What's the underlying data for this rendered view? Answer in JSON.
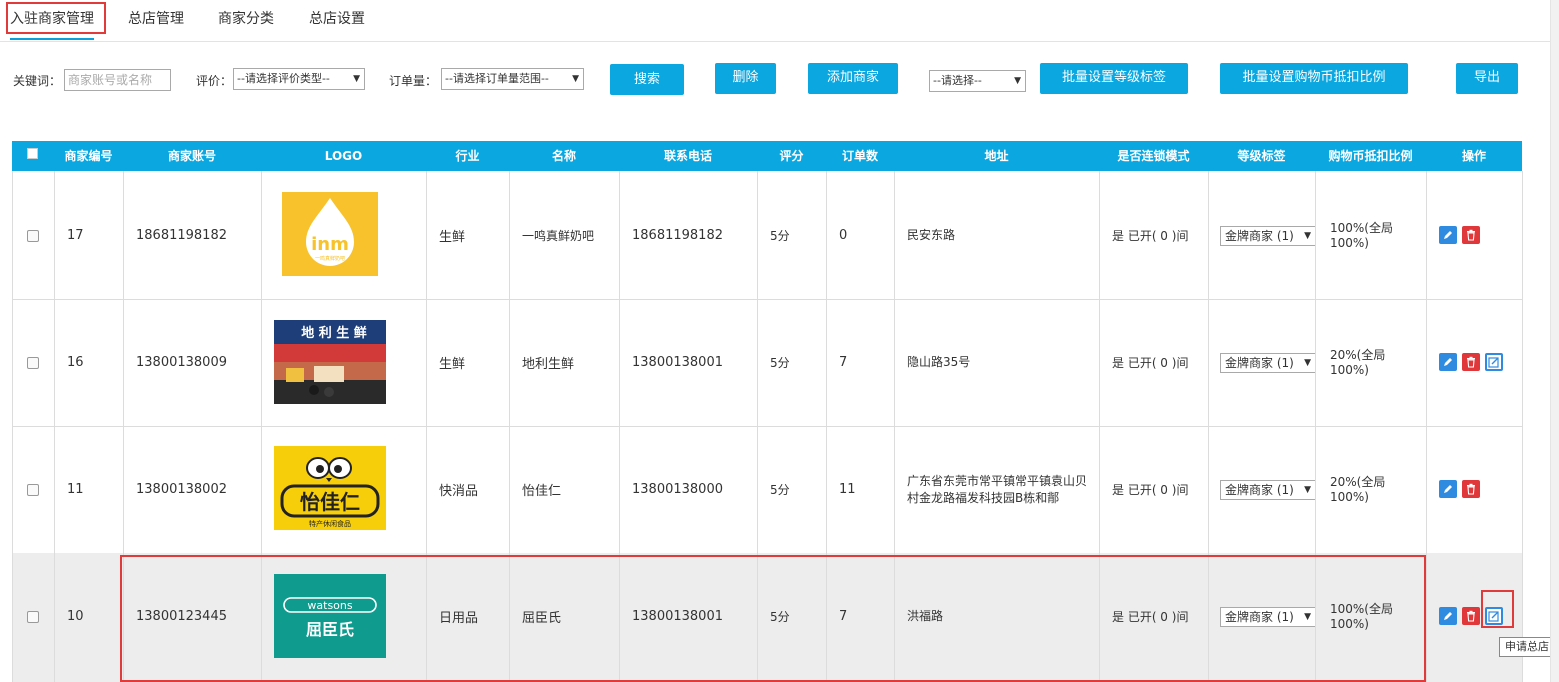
{
  "tabs": [
    {
      "label": "入驻商家管理",
      "active": true
    },
    {
      "label": "总店管理",
      "active": false
    },
    {
      "label": "商家分类",
      "active": false
    },
    {
      "label": "总店设置",
      "active": false
    }
  ],
  "filters": {
    "keyword_label": "关键词：",
    "keyword_placeholder": "商家账号或名称",
    "rating_label": "评价：",
    "rating_value": "--请选择评价类型--",
    "orders_label": "订单量：",
    "orders_value": "--请选择订单量范围--",
    "search_button": "搜索",
    "delete_button": "删除",
    "add_button": "添加商家",
    "batch_select_value": "--请选择--",
    "batch_level_button": "批量设置等级标签",
    "batch_coin_button": "批量设置购物币抵扣比例",
    "export_button": "导出"
  },
  "table": {
    "headers": [
      "商家编号",
      "商家账号",
      "LOGO",
      "行业",
      "名称",
      "联系电话",
      "评分",
      "订单数",
      "地址",
      "是否连锁模式",
      "等级标签",
      "购物币抵扣比例",
      "操作"
    ],
    "rows": [
      {
        "id": "17",
        "account": "18681198182",
        "logo": "inm-logo",
        "industry": "生鲜",
        "name": "一鸣真鲜奶吧",
        "phone": "18681198182",
        "score": "5分",
        "orders": "0",
        "address": "民安东路",
        "chain": "是 已开( 0 )间",
        "level": "金牌商家 (1)",
        "ratio_line1": "100%(全局",
        "ratio_line2": "100%)"
      },
      {
        "id": "16",
        "account": "13800138009",
        "logo": "dili-store-photo",
        "industry": "生鲜",
        "name": "地利生鲜",
        "phone": "13800138001",
        "score": "5分",
        "orders": "7",
        "address": "隐山路35号",
        "chain": "是 已开( 0 )间",
        "level": "金牌商家 (1)",
        "ratio_line1": "20%(全局",
        "ratio_line2": "100%)"
      },
      {
        "id": "11",
        "account": "13800138002",
        "logo": "yijiaren-logo",
        "industry": "快消品",
        "name": "怡佳仁",
        "phone": "13800138000",
        "score": "5分",
        "orders": "11",
        "address": "广东省东莞市常平镇常平镇袁山贝村金龙路福发科技园B栋和鄁",
        "chain": "是 已开( 0 )间",
        "level": "金牌商家 (1)",
        "ratio_line1": "20%(全局",
        "ratio_line2": "100%)"
      },
      {
        "id": "10",
        "account": "13800123445",
        "logo": "watsons-logo",
        "industry": "日用品",
        "name": "屈臣氏",
        "phone": "13800138001",
        "score": "5分",
        "orders": "7",
        "address": "洪福路",
        "chain": "是 已开( 0 )间",
        "level": "金牌商家 (1)",
        "ratio_line1": "100%(全局",
        "ratio_line2": "100%)"
      }
    ]
  },
  "logos": {
    "inm_text": "inm",
    "inm_sub": "一鸣真鲜奶吧",
    "dili_sign": "地 利 生 鲜",
    "yijiaren_text": "怡佳仁",
    "yijiaren_sub": "特产休闲食品",
    "watsons_text": "watsons",
    "watsons_cn": "屈臣氏"
  },
  "tooltip": "申请总店",
  "colors": {
    "accent": "#0aa7e0",
    "highlight": "#e03a3a",
    "row_selected": "#ededed"
  }
}
